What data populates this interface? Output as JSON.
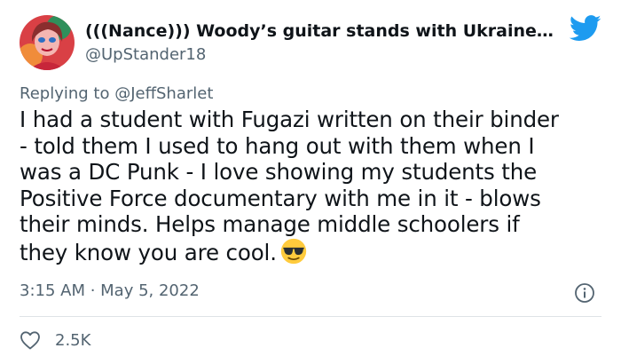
{
  "author": {
    "display_name": "(((Nance))) Woody’s guitar stands with Ukraine…",
    "handle": "@UpStander18",
    "avatar_icon": "user-avatar-photo"
  },
  "reply": {
    "prefix": "Replying to ",
    "mention": "@JeffSharlet"
  },
  "tweet": {
    "text": "I had a student with Fugazi written on their binder\n- told them I used to hang out with them when I\nwas a DC Punk - I love showing my students the\nPositive Force documentary with me in it - blows\ntheir minds. Helps manage middle schoolers if\nthey know you are cool.",
    "emoji": "sunglasses-emoji"
  },
  "meta": {
    "timestamp": "3:15 AM · May 5, 2022",
    "info_icon": "info-icon"
  },
  "engagement": {
    "like_count": "2.5K",
    "like_icon": "heart-icon"
  },
  "colors": {
    "twitter_blue": "#1d9bf0",
    "secondary_text": "#536471",
    "primary_text": "#0f1419",
    "emoji_yellow": "#ffcb3d"
  }
}
